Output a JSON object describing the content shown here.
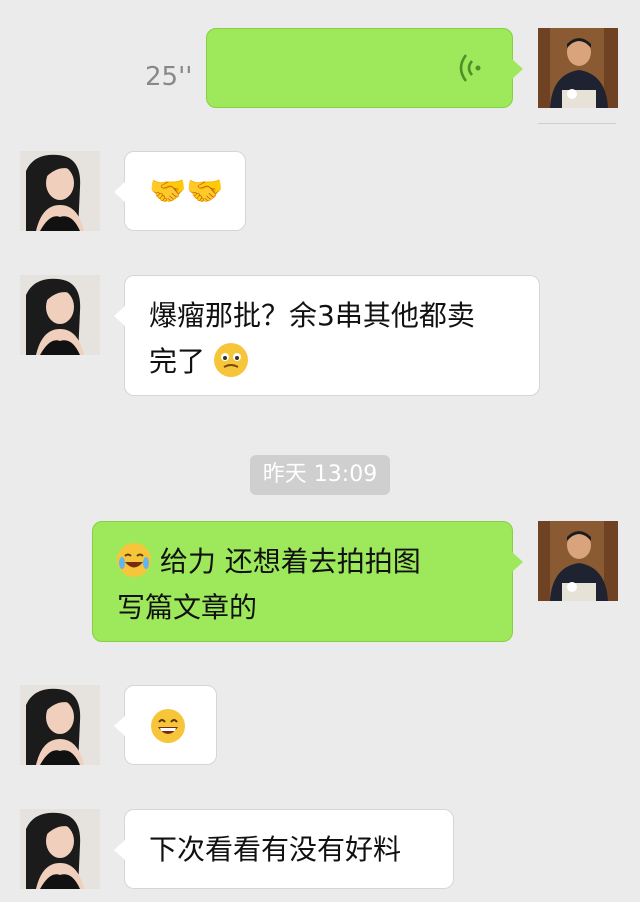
{
  "messages": {
    "voice": {
      "duration": "25''"
    },
    "m3": {
      "line1": "爆瘤那批？余3串其他都卖",
      "line2": "完了"
    },
    "timestamp": "昨天 13:09",
    "m4": {
      "line1": "给力 还想着去拍拍图",
      "line2": "写篇文章的"
    },
    "m6": {
      "text": "下次看看有没有好料"
    }
  },
  "colors": {
    "background": "#ebebeb",
    "sent_bubble": "#9ee95b",
    "received_bubble": "#ffffff"
  },
  "icons": [
    "voice-wave-icon",
    "handshake-emoji",
    "woozy-emoji",
    "laugh-cry-emoji",
    "grin-emoji"
  ]
}
